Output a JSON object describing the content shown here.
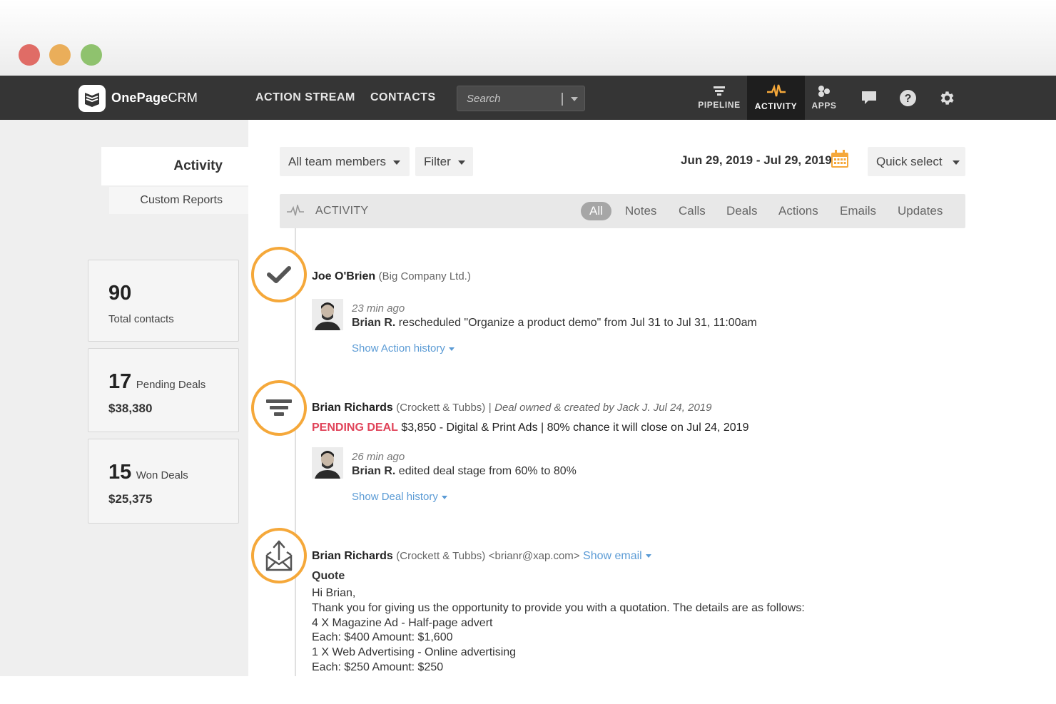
{
  "window": {
    "controls": [
      "close",
      "minimize",
      "maximize"
    ]
  },
  "nav": {
    "logo_bold": "OnePage",
    "logo_light": "CRM",
    "links": [
      "ACTION STREAM",
      "CONTACTS"
    ],
    "search_placeholder": "Search",
    "tabs": [
      {
        "label": "PIPELINE",
        "icon": "pipeline-icon"
      },
      {
        "label": "ACTIVITY",
        "icon": "activity-icon",
        "active": true
      },
      {
        "label": "APPS",
        "icon": "apps-icon"
      }
    ],
    "icons": [
      "chat-icon",
      "help-icon",
      "gear-icon"
    ]
  },
  "sidebar": {
    "active_tab": "Activity",
    "tab": "Custom Reports",
    "stats": [
      {
        "value": "90",
        "label": "Total contacts"
      },
      {
        "value": "17",
        "label": "Pending Deals",
        "amount": "$38,380"
      },
      {
        "value": "15",
        "label": "Won Deals",
        "amount": "$25,375"
      }
    ]
  },
  "toolbar": {
    "team": "All team members",
    "filter": "Filter",
    "date_range": "Jun 29, 2019 - Jul 29, 2019",
    "quick_select": "Quick select"
  },
  "activity_bar": {
    "title": "ACTIVITY",
    "filters": [
      "All",
      "Notes",
      "Calls",
      "Deals",
      "Actions",
      "Emails",
      "Updates"
    ],
    "active_filter": "All"
  },
  "entries": {
    "action": {
      "contact": "Joe O'Brien",
      "company": "(Big Company Ltd.)",
      "time": "23 min ago",
      "user": "Brian R.",
      "text": "rescheduled \"Organize a product demo\" from Jul 31 to Jul 31, 11:00am",
      "link": "Show Action history"
    },
    "deal": {
      "contact": "Brian Richards",
      "company": "(Crockett & Tubbs)",
      "sep": "|",
      "owner": "Deal owned & created by Jack J. Jul 24, 2019",
      "status": "PENDING DEAL",
      "details": "$3,850 - Digital & Print Ads",
      "chance": "80% chance it will close on Jul 24, 2019",
      "time": "26 min ago",
      "user": "Brian R.",
      "text": "edited deal stage from 60% to 80%",
      "link": "Show Deal history"
    },
    "email": {
      "contact": "Brian Richards",
      "company": "(Crockett & Tubbs)",
      "address": "<brianr@xap.com>",
      "link": "Show email",
      "subject": "Quote",
      "lines": [
        "Hi Brian,",
        "Thank you for giving us the opportunity to provide you with a quotation. The details are as follows:",
        "4 X Magazine Ad - Half-page advert",
        "Each: $400 Amount: $1,600",
        "1 X Web Advertising - Online advertising",
        "Each: $250 Amount: $250"
      ]
    }
  },
  "colors": {
    "accent": "#f5a83a",
    "link": "#5b9bd5",
    "pending": "#e0445a",
    "nav_bg": "#353535"
  }
}
